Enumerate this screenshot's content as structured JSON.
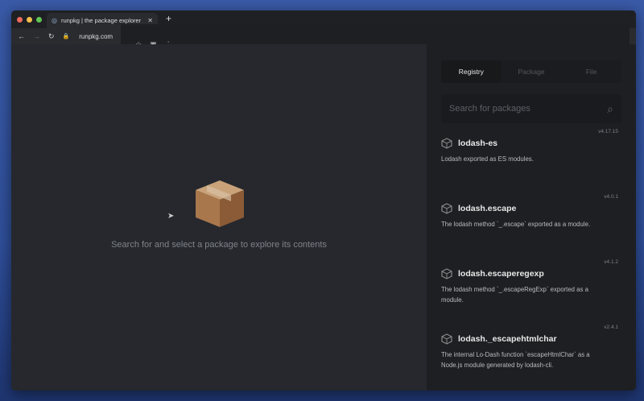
{
  "browser": {
    "tab_title": "runpkg | the package explorer",
    "url": "runpkg.com",
    "traffic_colors": [
      "#ed6a5e",
      "#f5bf4f",
      "#61c554"
    ]
  },
  "main": {
    "hint": "Search for and select a package to explore its contents"
  },
  "sidebar": {
    "tabs": [
      {
        "label": "Registry",
        "active": true
      },
      {
        "label": "Package"
      },
      {
        "label": "File"
      }
    ],
    "search_placeholder": "Search for packages",
    "packages": [
      {
        "name": "lodash-es",
        "version": "v4.17.15",
        "description": "Lodash exported as ES modules."
      },
      {
        "name": "lodash.escape",
        "version": "v4.0.1",
        "description": "The lodash method `_.escape` exported as a module."
      },
      {
        "name": "lodash.escaperegexp",
        "version": "v4.1.2",
        "description": "The lodash method `_.escapeRegExp` exported as a module."
      },
      {
        "name": "lodash._escapehtmlchar",
        "version": "v2.4.1",
        "description": "The internal Lo-Dash function `escapeHtmlChar` as a Node.js module generated by lodash-cli."
      }
    ]
  }
}
